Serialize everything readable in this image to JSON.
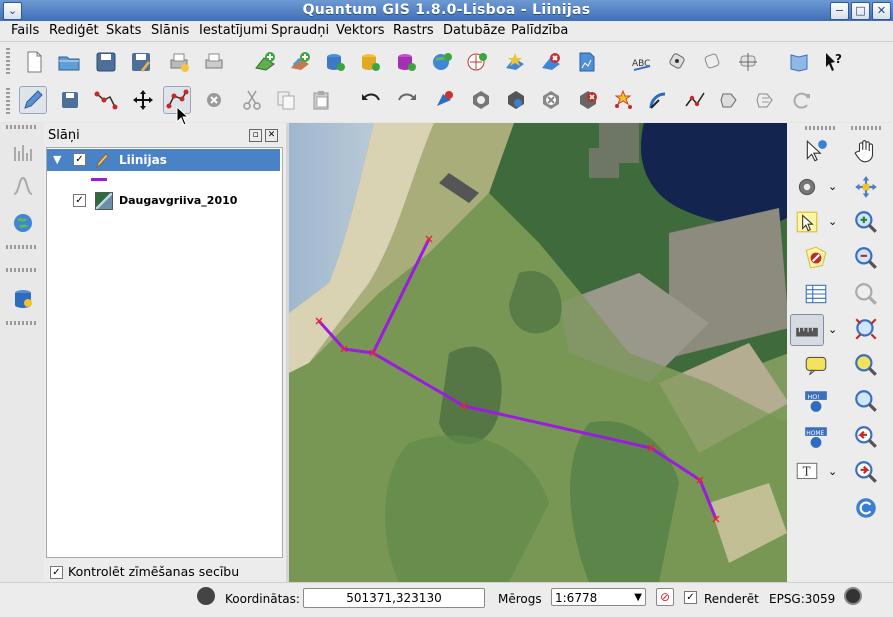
{
  "window": {
    "title": "Quantum GIS 1.8.0-Lisboa - Liinijas"
  },
  "menu": [
    "Fails",
    "Rediģēt",
    "Skats",
    "Slānis",
    "Iestatījumi",
    "Spraudņi",
    "Vektors",
    "Rastrs",
    "Datubāze",
    "Palīdzība"
  ],
  "layers_panel": {
    "title": "Slāņi",
    "layers": [
      {
        "name": "Liinijas",
        "checked": true,
        "selected": true
      },
      {
        "name": "Daugavgriiva_2010",
        "checked": true,
        "selected": false
      }
    ],
    "render_order_label": "Kontrolēt zīmēšanas secību",
    "render_order_checked": true
  },
  "status": {
    "coordinates_label": "Koordinātas:",
    "coordinates_value": "501371,323130",
    "scale_label": "Mērogs",
    "scale_value": "1:6778",
    "render_label": "Renderēt",
    "crs": "EPSG:3059"
  },
  "colors": {
    "accent": "#4a82c7",
    "line_feature": "#9b1ce0"
  }
}
